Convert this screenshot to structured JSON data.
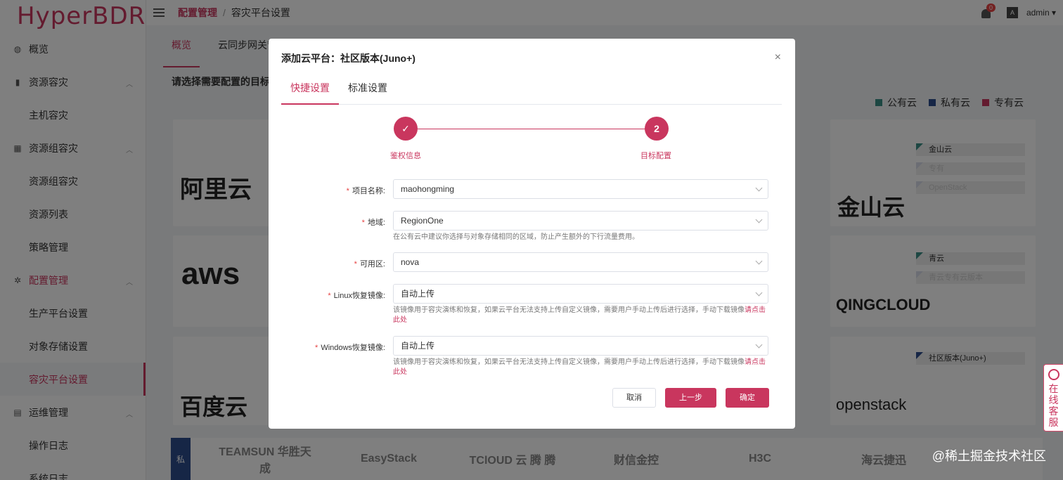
{
  "app": {
    "logo": "HyperBDR"
  },
  "header": {
    "breadcrumb_1": "配置管理",
    "breadcrumb_sep": "/",
    "breadcrumb_2": "容灾平台设置",
    "notification_count": "0",
    "lang_icon": "A",
    "user": "admin ▾"
  },
  "sidebar": {
    "items": [
      {
        "type": "group",
        "label": "概览",
        "icon": "dashboard-icon"
      },
      {
        "type": "group",
        "label": "资源容灾",
        "icon": "server-icon"
      },
      {
        "type": "sub",
        "label": "主机容灾"
      },
      {
        "type": "group",
        "label": "资源组容灾",
        "icon": "grid-icon"
      },
      {
        "type": "sub",
        "label": "资源组容灾"
      },
      {
        "type": "sub",
        "label": "资源列表"
      },
      {
        "type": "sub",
        "label": "策略管理"
      },
      {
        "type": "group",
        "label": "配置管理",
        "icon": "gear-icon"
      },
      {
        "type": "sub",
        "label": "生产平台设置"
      },
      {
        "type": "sub",
        "label": "对象存储设置"
      },
      {
        "type": "sub",
        "label": "容灾平台设置"
      },
      {
        "type": "group",
        "label": "运维管理",
        "icon": "document-icon"
      },
      {
        "type": "sub",
        "label": "操作日志"
      },
      {
        "type": "sub",
        "label": "系统日志"
      }
    ]
  },
  "main": {
    "tabs": [
      "概览",
      "云同步网关管"
    ],
    "section_title": "请选择需要配置的目标平",
    "legend": [
      {
        "label": "公有云",
        "color": "#3a8e86"
      },
      {
        "label": "私有云",
        "color": "#2c4c8c"
      },
      {
        "label": "专有云",
        "color": "#c9365e"
      }
    ],
    "cards_left": [
      "阿里云",
      "aws",
      "百度云"
    ],
    "cards_right": [
      {
        "brand": "金山云",
        "tags": [
          "金山云",
          "专有",
          "OpenStack"
        ]
      },
      {
        "brand": "QINGCLOUD",
        "tags": [
          "青云",
          "青云专有云版本"
        ]
      },
      {
        "brand": "openstack",
        "tags": [
          "社区版本(Juno+)"
        ]
      }
    ],
    "strip_label": "私",
    "strip_logos": [
      "TEAMSUN 华胜天成",
      "EasyStack",
      "TClOUD 云 腾 腾",
      "财信金控",
      "H3C",
      "海云捷迅"
    ],
    "watermark": "@稀土掘金技术社区"
  },
  "service_tab": {
    "label": "在线客服"
  },
  "dialog": {
    "title": "添加云平台：社区版本(Juno+)",
    "close": "×",
    "tabs": [
      "快捷设置",
      "标准设置"
    ],
    "steps": [
      {
        "label": "鉴权信息",
        "mark": "✓"
      },
      {
        "label": "目标配置",
        "mark": "2"
      }
    ],
    "fields": {
      "project": {
        "label": "项目名称:",
        "value": "maohongming"
      },
      "region": {
        "label": "地域:",
        "value": "RegionOne",
        "hint": "在公有云中建议你选择与对象存储相同的区域，防止产生额外的下行流量费用。"
      },
      "zone": {
        "label": "可用区:",
        "value": "nova"
      },
      "linux_image": {
        "label": "Linux恢复镜像:",
        "value": "自动上传",
        "hint": "该镜像用于容灾演练和恢复，如果云平台无法支持上传自定义镜像，需要用户手动上传后进行选择，手动下载镜像",
        "link": "请点击此处"
      },
      "windows_image": {
        "label": "Windows恢复镜像:",
        "value": "自动上传",
        "hint": "该镜像用于容灾演练和恢复，如果云平台无法支持上传自定义镜像，需要用户手动上传后进行选择，手动下载镜像",
        "link": "请点击此处"
      }
    },
    "required_mark": "*",
    "buttons": {
      "cancel": "取消",
      "prev": "上一步",
      "ok": "确定"
    }
  }
}
